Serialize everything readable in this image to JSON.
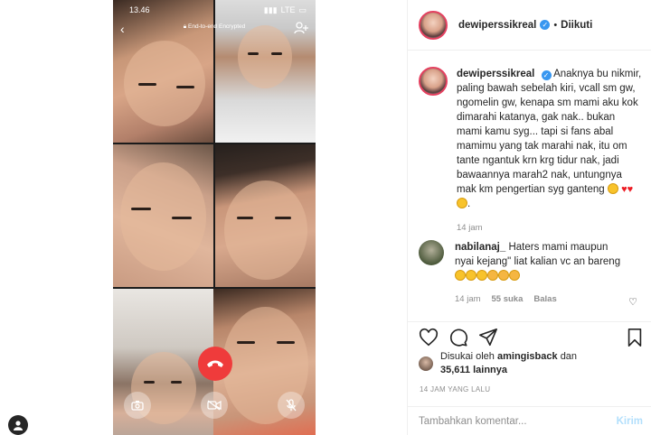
{
  "call": {
    "status_time": "13.46",
    "network": "LTE",
    "encryption_label": "End-to-end Encrypted",
    "icons": [
      "back-arrow-icon",
      "add-participant-icon",
      "camera-flip-icon",
      "end-call-icon",
      "video-off-icon",
      "mic-off-icon"
    ],
    "end_call_color": "#ef3b3b"
  },
  "post": {
    "username": "dewiperssikreal",
    "follow_status": "Diikuti",
    "separator": "•",
    "caption_user": "dewiperssikreal",
    "caption": "Anaknya bu nikmir, paling bawah sebelah kiri, vcall sm gw, ngomelin gw, kenapa sm mami aku kok dimarahi katanya, gak nak.. bukan mami kamu syg... tapi si fans abal mamimu yang tak marahi nak, itu om tante ngantuk krn krg tidur nak, jadi bawaannya marah2 nak, untungnya mak km pengertian syg ganteng",
    "caption_time": "14 jam",
    "comment": {
      "user": "nabilanaj_",
      "text": "Haters mami maupun nyai kejang\" liat kalian vc an bareng",
      "time": "14 jam",
      "likes": "55 suka",
      "reply": "Balas"
    },
    "liked_by_prefix": "Disukai oleh",
    "liked_by_user": "amingisback",
    "liked_by_and": "dan",
    "like_count": "35,611 lainnya",
    "timestamp": "14 JAM YANG LALU",
    "comment_placeholder": "Tambahkan komentar...",
    "post_button": "Kirim",
    "verified_color": "#3897f0"
  }
}
